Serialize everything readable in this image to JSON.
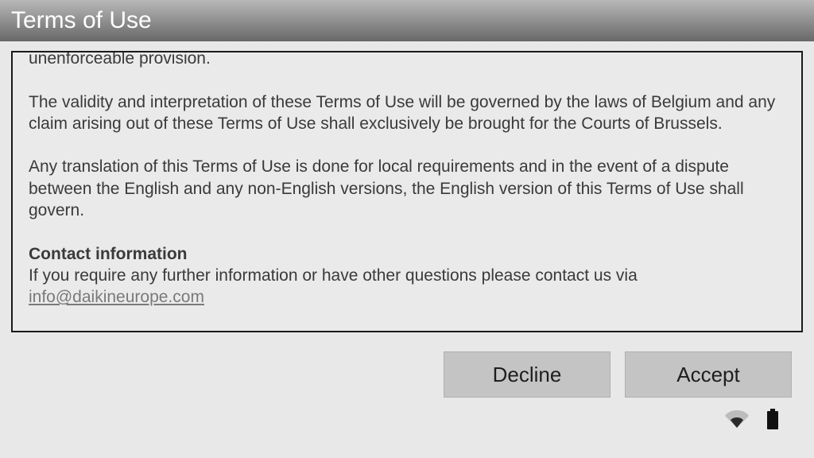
{
  "header": {
    "title": "Terms of Use"
  },
  "terms": {
    "partial_line": "unenforceable provision.",
    "para1": "The validity and interpretation of these Terms of Use will be governed by the laws of Belgium and any claim arising out of these Terms of Use shall exclusively be brought for the Courts of Brussels.",
    "para2": "Any translation of this Terms of Use is done for local requirements and in the event of a dispute between the English and any non-English versions, the English version of this Terms of Use shall govern.",
    "contact_heading": "Contact information",
    "contact_text": "If you require any further information or have other questions please contact us via ",
    "contact_email": "info@daikineurope.com"
  },
  "buttons": {
    "decline": "Decline",
    "accept": "Accept"
  }
}
